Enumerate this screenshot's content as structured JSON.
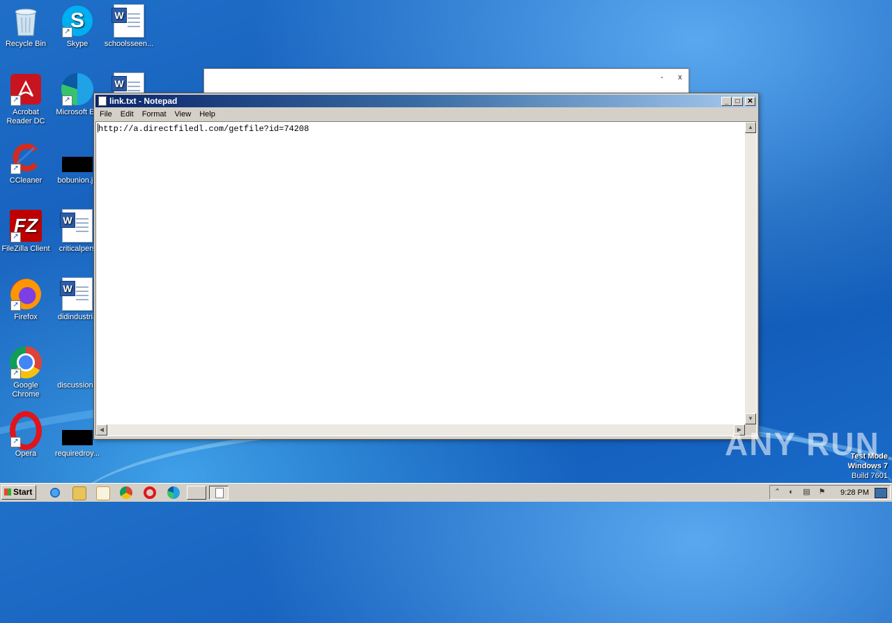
{
  "desktop": {
    "icons": [
      {
        "label": "Recycle Bin"
      },
      {
        "label": "Skype"
      },
      {
        "label": "schoolsseen..."
      },
      {
        "label": "Acrobat Reader DC"
      },
      {
        "label": "Microsoft Ed"
      },
      {
        "label": "CCleaner"
      },
      {
        "label": "bobunion.jp"
      },
      {
        "label": "FileZilla Client"
      },
      {
        "label": "criticalpers"
      },
      {
        "label": "Firefox"
      },
      {
        "label": "didindustria"
      },
      {
        "label": "Google Chrome"
      },
      {
        "label": "discussionh"
      },
      {
        "label": "Opera"
      },
      {
        "label": "requiredroy..."
      }
    ]
  },
  "back_window": {
    "minimize": "-",
    "close": "x"
  },
  "notepad": {
    "title": "link.txt - Notepad",
    "menu": [
      "File",
      "Edit",
      "Format",
      "View",
      "Help"
    ],
    "content": "http://a.directfiledl.com/getfile?id=74208",
    "buttons": {
      "minimize": "_",
      "maximize": "□",
      "close": "✕"
    }
  },
  "watermark": {
    "brand": "ANY RUN",
    "mode": "Test Mode",
    "os": "Windows 7",
    "build": "Build 7601"
  },
  "taskbar": {
    "start_label": "Start",
    "clock": "9:28 PM",
    "quick_launch": [
      "internet-explorer-icon",
      "explorer-icon",
      "media-player-icon",
      "chrome-icon",
      "opera-icon",
      "edge-icon"
    ]
  }
}
